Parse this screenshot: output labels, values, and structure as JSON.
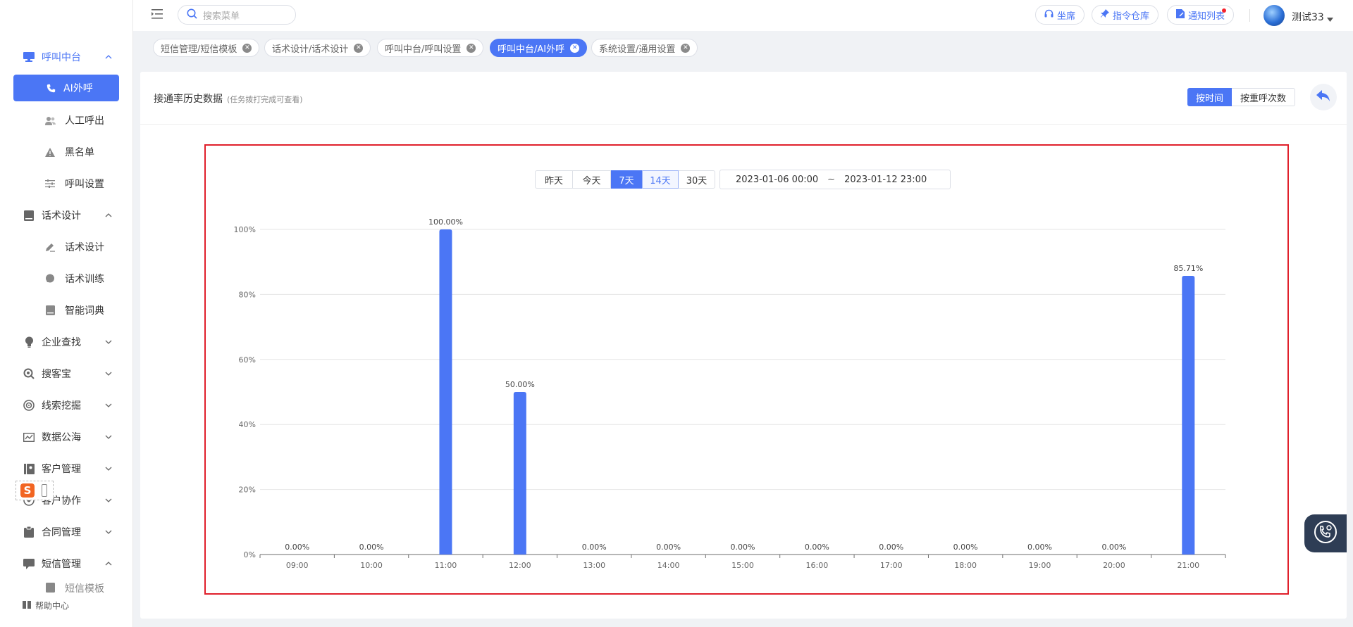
{
  "sidebar": {
    "groups": [
      {
        "label": "呼叫中台"
      },
      {
        "label": "话术设计"
      },
      {
        "label": "企业查找"
      },
      {
        "label": "搜客宝"
      },
      {
        "label": "线索挖掘"
      },
      {
        "label": "数据公海"
      },
      {
        "label": "客户管理"
      },
      {
        "label": "客户协作"
      },
      {
        "label": "合同管理"
      },
      {
        "label": "短信管理"
      }
    ],
    "call_items": [
      {
        "label": "AI外呼"
      },
      {
        "label": "人工呼出"
      },
      {
        "label": "黑名单"
      },
      {
        "label": "呼叫设置"
      }
    ],
    "script_items": [
      {
        "label": "话术设计"
      },
      {
        "label": "话术训练"
      },
      {
        "label": "智能词典"
      }
    ],
    "sms_items": [
      {
        "label": "短信模板"
      }
    ],
    "help": "帮助中心"
  },
  "header": {
    "search_placeholder": "搜索菜单",
    "buttons": {
      "seat": "坐席",
      "command": "指令仓库",
      "notify": "通知列表"
    },
    "user": "测试33"
  },
  "tabs": [
    {
      "label": "短信管理/短信模板",
      "active": false
    },
    {
      "label": "话术设计/话术设计",
      "active": false
    },
    {
      "label": "呼叫中台/呼叫设置",
      "active": false
    },
    {
      "label": "呼叫中台/AI外呼",
      "active": true
    },
    {
      "label": "系统设置/通用设置",
      "active": false
    }
  ],
  "card": {
    "title": "接通率历史数据",
    "subtitle": "(任务拨打完成可查看)",
    "mode_by_time": "按时间",
    "mode_by_calls": "按重呼次数"
  },
  "range": {
    "buttons": [
      {
        "label": "昨天",
        "state": "normal"
      },
      {
        "label": "今天",
        "state": "normal"
      },
      {
        "label": "7天",
        "state": "selected"
      },
      {
        "label": "14天",
        "state": "hover"
      },
      {
        "label": "30天",
        "state": "normal"
      }
    ],
    "start": "2023-01-06 00:00",
    "sep": "~",
    "end": "2023-01-12 23:00"
  },
  "chart_data": {
    "type": "bar",
    "title": "",
    "xlabel": "",
    "ylabel": "",
    "categories": [
      "09:00",
      "10:00",
      "11:00",
      "12:00",
      "13:00",
      "14:00",
      "15:00",
      "16:00",
      "17:00",
      "18:00",
      "19:00",
      "20:00",
      "21:00"
    ],
    "values": [
      0,
      0,
      100,
      50,
      0,
      0,
      0,
      0,
      0,
      0,
      0,
      0,
      85.71
    ],
    "data_labels": [
      "0.00%",
      "0.00%",
      "100.00%",
      "50.00%",
      "0.00%",
      "0.00%",
      "0.00%",
      "0.00%",
      "0.00%",
      "0.00%",
      "0.00%",
      "0.00%",
      "85.71%"
    ],
    "y_ticks": [
      "0%",
      "20%",
      "40%",
      "60%",
      "80%",
      "100%"
    ],
    "ylim": [
      0,
      100
    ],
    "grid": true,
    "bar_color": "#4b76f5"
  },
  "colors": {
    "accent": "#4b76f5",
    "highlight_box": "#e0202b"
  }
}
